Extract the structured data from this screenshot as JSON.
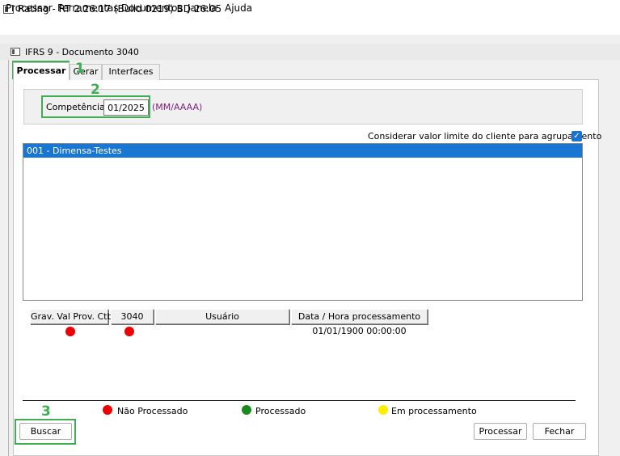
{
  "app": {
    "title": "Rating - RT 2.26.17 (Build 0219) BD 26.05"
  },
  "menu": [
    "Processar",
    "Ferramentas",
    "Documentos",
    "Janela",
    "Ajuda"
  ],
  "window": {
    "title": "IFRS 9 - Documento 3040"
  },
  "tabs": [
    "Processar",
    "Gerar",
    "Interfaces"
  ],
  "competencia": {
    "label": "Competência",
    "value": "01/2025",
    "format_hint": "(MM/AAAA)"
  },
  "agrupamento": {
    "label": "Considerar valor limite do cliente para agrupamento",
    "checked": true
  },
  "empresa_list": [
    "001 - Dimensa-Testes"
  ],
  "status_grid": {
    "columns": [
      "Grav. Val Prov. Ctb",
      "3040",
      "Usuário",
      "Data / Hora processamento"
    ],
    "row": {
      "grav_status": "nao-processado",
      "status_3040": "nao-processado",
      "usuario": "",
      "data_hora": "01/01/1900 00:00:00"
    }
  },
  "legend": [
    "Não Processado",
    "Processado",
    "Em processamento"
  ],
  "buttons": {
    "buscar": "Buscar",
    "processar": "Processar",
    "fechar": "Fechar"
  },
  "annotations": [
    "1",
    "2",
    "3"
  ],
  "colors": {
    "selection": "#1976d2",
    "annotation": "#3fae55",
    "nao_processado": "#ee0000",
    "processado": "#1a8a1a",
    "em_processamento": "#ffee00",
    "format_hint": "#7d1e7d"
  }
}
